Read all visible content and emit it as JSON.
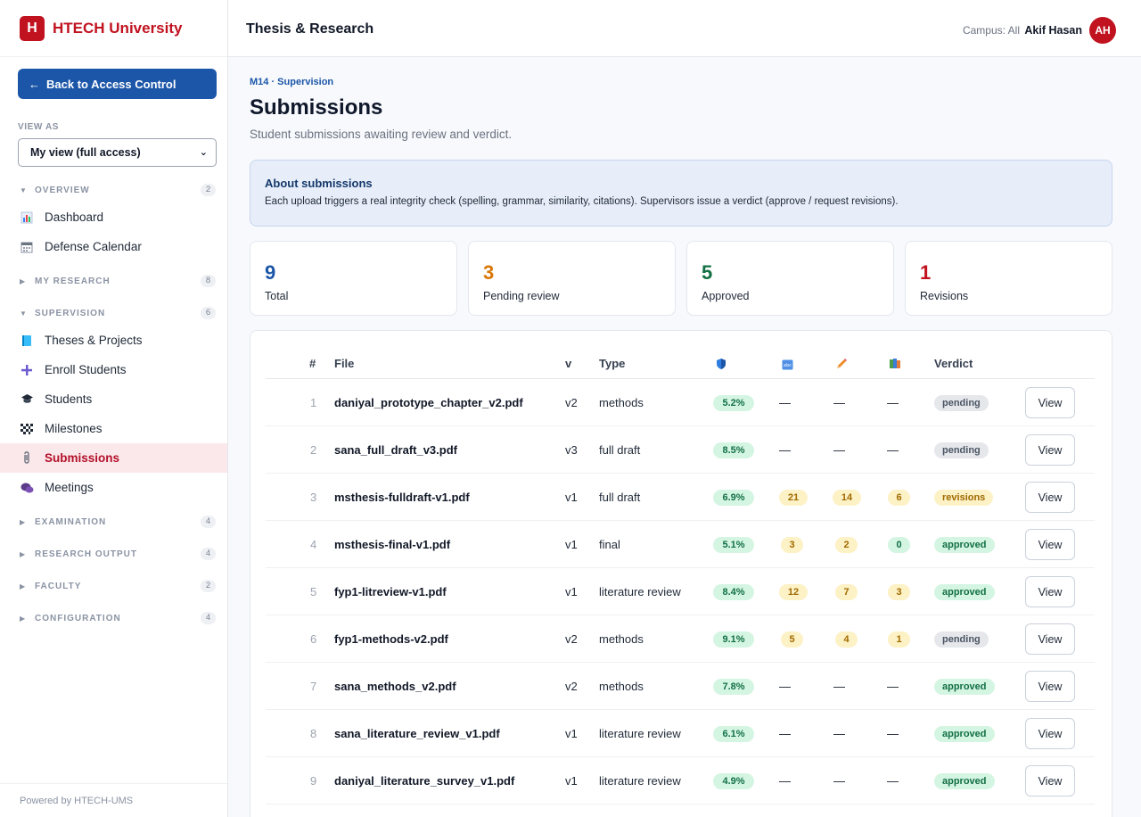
{
  "brand": {
    "logo_letter": "H",
    "name": "HTECH University"
  },
  "sidebar": {
    "back_button": "Back to Access Control",
    "view_as_label": "VIEW AS",
    "view_as_value": "My view (full access)",
    "sections": [
      {
        "label": "OVERVIEW",
        "count": "2",
        "expanded": true,
        "items": [
          {
            "label": "Dashboard",
            "icon": "bar-chart-icon"
          },
          {
            "label": "Defense Calendar",
            "icon": "calendar-icon"
          }
        ]
      },
      {
        "label": "MY RESEARCH",
        "count": "8",
        "expanded": false
      },
      {
        "label": "SUPERVISION",
        "count": "6",
        "expanded": true,
        "items": [
          {
            "label": "Theses & Projects",
            "icon": "book-icon"
          },
          {
            "label": "Enroll Students",
            "icon": "plus-icon"
          },
          {
            "label": "Students",
            "icon": "graduation-cap-icon"
          },
          {
            "label": "Milestones",
            "icon": "checkered-flag-icon"
          },
          {
            "label": "Submissions",
            "icon": "paperclip-icon",
            "active": true
          },
          {
            "label": "Meetings",
            "icon": "chat-bubbles-icon"
          }
        ]
      },
      {
        "label": "EXAMINATION",
        "count": "4",
        "expanded": false
      },
      {
        "label": "RESEARCH OUTPUT",
        "count": "4",
        "expanded": false
      },
      {
        "label": "FACULTY",
        "count": "2",
        "expanded": false
      },
      {
        "label": "CONFIGURATION",
        "count": "4",
        "expanded": false
      }
    ],
    "footer": "Powered by HTECH-UMS"
  },
  "topbar": {
    "title": "Thesis & Research",
    "campus": "Campus: All",
    "user_name": "Akif Hasan",
    "user_initials": "AH"
  },
  "page": {
    "breadcrumb": "M14 · Supervision",
    "title": "Submissions",
    "subtitle": "Student submissions awaiting review and verdict.",
    "info_title": "About submissions",
    "info_text": "Each upload triggers a real integrity check (spelling, grammar, similarity, citations). Supervisors issue a verdict (approve / request revisions)."
  },
  "stats": [
    {
      "value": "9",
      "label": "Total",
      "color": "#1c56a8"
    },
    {
      "value": "3",
      "label": "Pending review",
      "color": "#d97706"
    },
    {
      "value": "5",
      "label": "Approved",
      "color": "#127044"
    },
    {
      "value": "1",
      "label": "Revisions",
      "color": "#c1121f"
    }
  ],
  "table": {
    "headers": {
      "index": "#",
      "file": "File",
      "version": "v",
      "type": "Type",
      "verdict": "Verdict"
    },
    "icon_headers": [
      "shield-icon",
      "abc-spelling-icon",
      "pencil-icon",
      "books-icon"
    ],
    "view_label": "View",
    "rows": [
      {
        "index": "1",
        "file": "daniyal_prototype_chapter_v2.pdf",
        "version": "v2",
        "type": "methods",
        "similarity": "5.2%",
        "spelling": "—",
        "grammar": "—",
        "citations": "—",
        "verdict": "pending"
      },
      {
        "index": "2",
        "file": "sana_full_draft_v3.pdf",
        "version": "v3",
        "type": "full draft",
        "similarity": "8.5%",
        "spelling": "—",
        "grammar": "—",
        "citations": "—",
        "verdict": "pending"
      },
      {
        "index": "3",
        "file": "msthesis-fulldraft-v1.pdf",
        "version": "v1",
        "type": "full draft",
        "similarity": "6.9%",
        "spelling": "21",
        "grammar": "14",
        "citations": "6",
        "verdict": "revisions"
      },
      {
        "index": "4",
        "file": "msthesis-final-v1.pdf",
        "version": "v1",
        "type": "final",
        "similarity": "5.1%",
        "spelling": "3",
        "grammar": "2",
        "citations": "0",
        "verdict": "approved"
      },
      {
        "index": "5",
        "file": "fyp1-litreview-v1.pdf",
        "version": "v1",
        "type": "literature review",
        "similarity": "8.4%",
        "spelling": "12",
        "grammar": "7",
        "citations": "3",
        "verdict": "approved"
      },
      {
        "index": "6",
        "file": "fyp1-methods-v2.pdf",
        "version": "v2",
        "type": "methods",
        "similarity": "9.1%",
        "spelling": "5",
        "grammar": "4",
        "citations": "1",
        "verdict": "pending"
      },
      {
        "index": "7",
        "file": "sana_methods_v2.pdf",
        "version": "v2",
        "type": "methods",
        "similarity": "7.8%",
        "spelling": "—",
        "grammar": "—",
        "citations": "—",
        "verdict": "approved"
      },
      {
        "index": "8",
        "file": "sana_literature_review_v1.pdf",
        "version": "v1",
        "type": "literature review",
        "similarity": "6.1%",
        "spelling": "—",
        "grammar": "—",
        "citations": "—",
        "verdict": "approved"
      },
      {
        "index": "9",
        "file": "daniyal_literature_survey_v1.pdf",
        "version": "v1",
        "type": "literature review",
        "similarity": "4.9%",
        "spelling": "—",
        "grammar": "—",
        "citations": "—",
        "verdict": "approved"
      }
    ]
  }
}
